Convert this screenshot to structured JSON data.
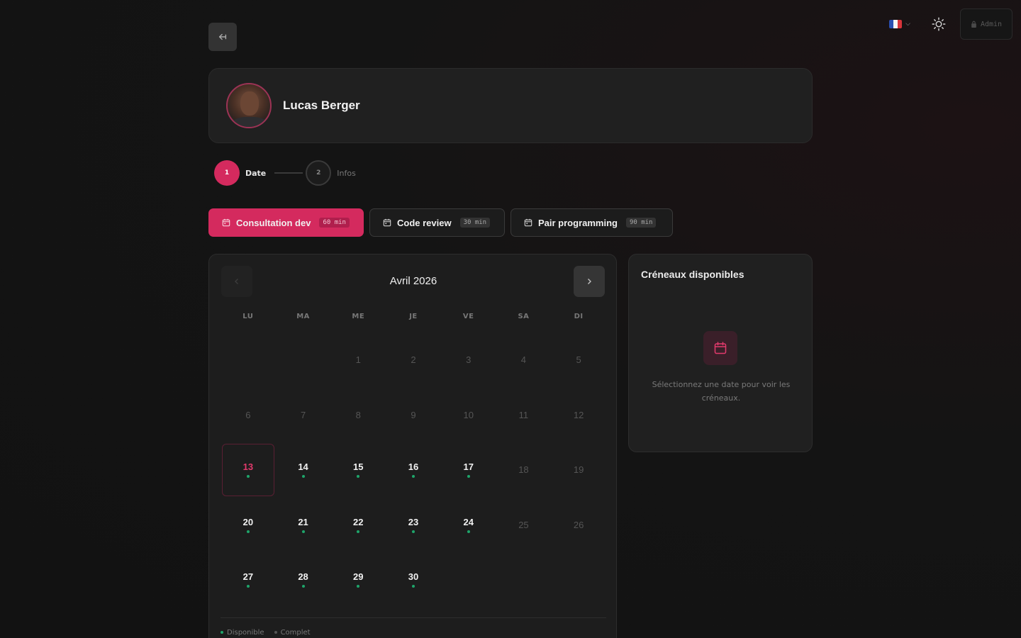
{
  "topbar": {
    "language": "FR",
    "admin_label": "Admin"
  },
  "colors": {
    "accent": "#d42a5e",
    "available": "#1ea56a"
  },
  "profile": {
    "name": "Lucas Berger"
  },
  "stepper": {
    "steps": [
      {
        "number": "1",
        "label": "Date"
      },
      {
        "number": "2",
        "label": "Infos"
      }
    ]
  },
  "services": [
    {
      "label": "Consultation dev",
      "duration": "60 min"
    },
    {
      "label": "Code review",
      "duration": "30 min"
    },
    {
      "label": "Pair programming",
      "duration": "90 min"
    }
  ],
  "calendar": {
    "month": "Avril 2026",
    "weekdays": [
      "LU",
      "MA",
      "ME",
      "JE",
      "VE",
      "SA",
      "DI"
    ],
    "legend": {
      "available": "Disponible",
      "full": "Complet"
    }
  },
  "slots": {
    "title": "Créneaux disponibles",
    "empty_message": "Sélectionnez une date pour voir les créneaux."
  }
}
